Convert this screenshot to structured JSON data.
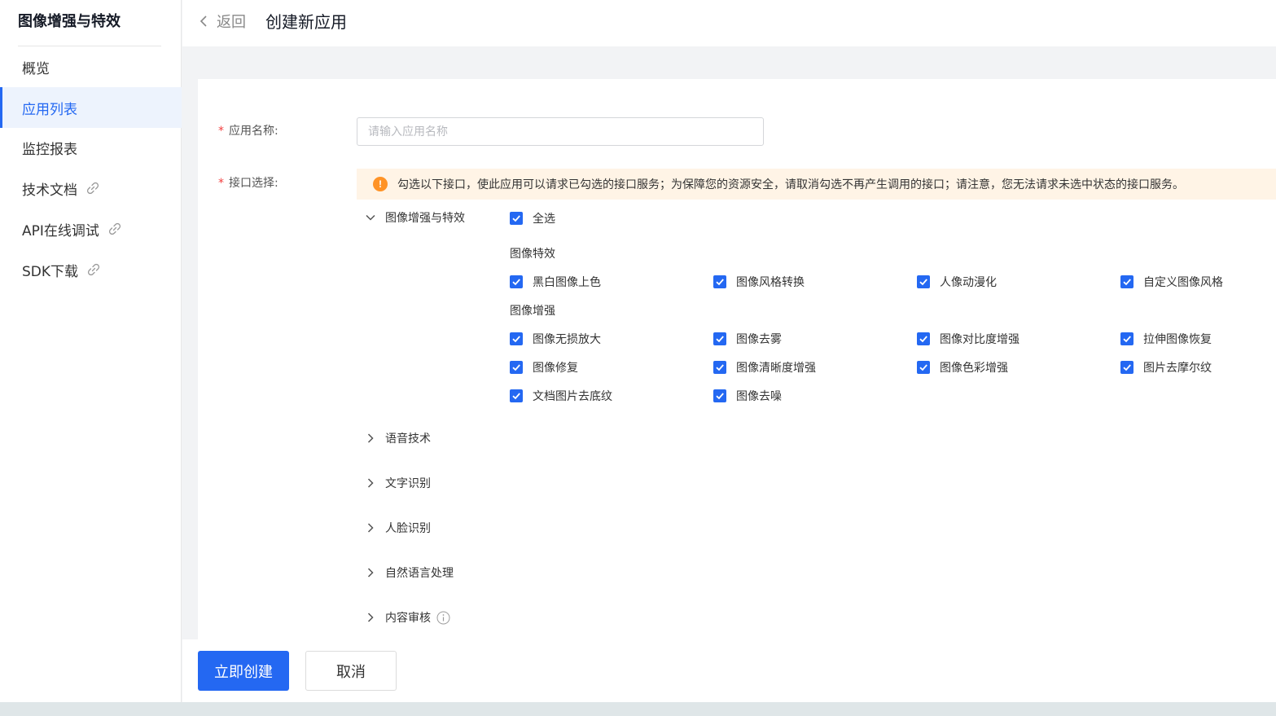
{
  "sidebar": {
    "title": "图像增强与特效",
    "items": [
      {
        "label": "概览"
      },
      {
        "label": "应用列表"
      },
      {
        "label": "监控报表"
      },
      {
        "label": "技术文档"
      },
      {
        "label": "API在线调试"
      },
      {
        "label": "SDK下载"
      }
    ]
  },
  "header": {
    "back_label": "返回",
    "title": "创建新应用"
  },
  "form": {
    "name_label": "应用名称:",
    "name_placeholder": "请输入应用名称",
    "name_value": "",
    "api_label": "接口选择:",
    "notice": "勾选以下接口，使此应用可以请求已勾选的接口服务；为保障您的资源安全，请取消勾选不再产生调用的接口；请注意，您无法请求未选中状态的接口服务。"
  },
  "groups": {
    "expanded": {
      "name": "图像增强与特效",
      "select_all": "全选",
      "sections": [
        {
          "title": "图像特效",
          "items": [
            "黑白图像上色",
            "图像风格转换",
            "人像动漫化",
            "自定义图像风格"
          ]
        },
        {
          "title": "图像增强",
          "items": [
            "图像无损放大",
            "图像去雾",
            "图像对比度增强",
            "拉伸图像恢复",
            "图像修复",
            "图像清晰度增强",
            "图像色彩增强",
            "图片去摩尔纹",
            "文档图片去底纹",
            "图像去噪"
          ]
        }
      ]
    },
    "collapsed": [
      {
        "name": "语音技术"
      },
      {
        "name": "文字识别"
      },
      {
        "name": "人脸识别"
      },
      {
        "name": "自然语言处理"
      },
      {
        "name": "内容审核"
      }
    ]
  },
  "footer": {
    "create_label": "立即创建",
    "cancel_label": "取消"
  },
  "colors": {
    "accent": "#2468f2",
    "warning": "#ff9326",
    "required": "#f33e3e"
  }
}
